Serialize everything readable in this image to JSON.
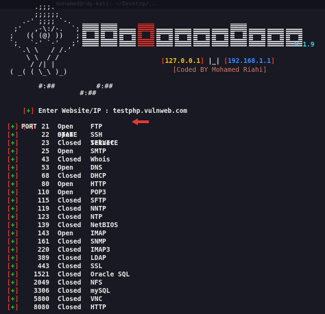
{
  "tab_title": "mohamed@rdp-kali: ~/Desktop/...",
  "ascii_art": {
    "lines": [
      "       .;;;.",
      "       ;;;;;;",
      "    .-' ;;;; `-.  ",
      "  ;'   ,-\\:/-.  `;",
      " ;   (( (@) ))   ;",
      " `;   `-' `-'   ;'",
      "   `.\\ \\   / /.'",
      "     \\ \\  / /",
      "      / /| |",
      " ( _( ( \\_\\ )_)",
      "",
      "        #:##          #:##",
      "                  #:##"
    ]
  },
  "banner": {
    "title": "TheInspektor",
    "version": "V 1.9",
    "ip_local": "127.0.0.1",
    "separator": " |_| ",
    "ip_remote": "192.168.1.1",
    "credit": "Coded BY Mohamed Riahi",
    "colors": {
      "banner_fill": "#e6e6e6",
      "accent_red": "#e53935",
      "ip_local": "#ffc107",
      "ip_remote": "#3d8bff",
      "credit": "#d07a6c",
      "version": "#3ed3e6"
    }
  },
  "prompt": {
    "open": "[",
    "plus": "+",
    "close": "]",
    "label": " Enter Website/IP : ",
    "value": "testphp.vulnweb.com"
  },
  "table": {
    "headers": {
      "port": "PORT",
      "state": "STATE",
      "service": "SERVICE"
    },
    "rows": [
      {
        "port": "21",
        "state": "Open",
        "service": "FTP"
      },
      {
        "port": "22",
        "state": "Open",
        "service": "SSH"
      },
      {
        "port": "23",
        "state": "Closed",
        "service": "Telnet"
      },
      {
        "port": "25",
        "state": "Open",
        "service": "SMTP"
      },
      {
        "port": "43",
        "state": "Closed",
        "service": "Whois"
      },
      {
        "port": "53",
        "state": "Open",
        "service": "DNS"
      },
      {
        "port": "68",
        "state": "Closed",
        "service": "DHCP"
      },
      {
        "port": "80",
        "state": "Open",
        "service": "HTTP"
      },
      {
        "port": "110",
        "state": "Open",
        "service": "POP3"
      },
      {
        "port": "115",
        "state": "Closed",
        "service": "SFTP"
      },
      {
        "port": "119",
        "state": "Closed",
        "service": "NNTP"
      },
      {
        "port": "123",
        "state": "Closed",
        "service": "NTP"
      },
      {
        "port": "139",
        "state": "Closed",
        "service": "NetBIOS"
      },
      {
        "port": "143",
        "state": "Open",
        "service": "IMAP"
      },
      {
        "port": "161",
        "state": "Closed",
        "service": "SNMP"
      },
      {
        "port": "220",
        "state": "Closed",
        "service": "IMAP3"
      },
      {
        "port": "389",
        "state": "Closed",
        "service": "LDAP"
      },
      {
        "port": "443",
        "state": "Closed",
        "service": "SSL"
      },
      {
        "port": "1521",
        "state": "Closed",
        "service": "Oracle SQL"
      },
      {
        "port": "2049",
        "state": "Closed",
        "service": "NFS"
      },
      {
        "port": "3306",
        "state": "Closed",
        "service": "mySQL"
      },
      {
        "port": "5800",
        "state": "Closed",
        "service": "VNC"
      },
      {
        "port": "8080",
        "state": "Closed",
        "service": "HTTP"
      }
    ]
  },
  "icons": {
    "arrow": "left-arrow-icon"
  },
  "colors": {
    "background": "#181922",
    "text": "#e8e8e8",
    "bracket": "#e53935",
    "plus": "#28c840",
    "arrow": "#e53935"
  }
}
